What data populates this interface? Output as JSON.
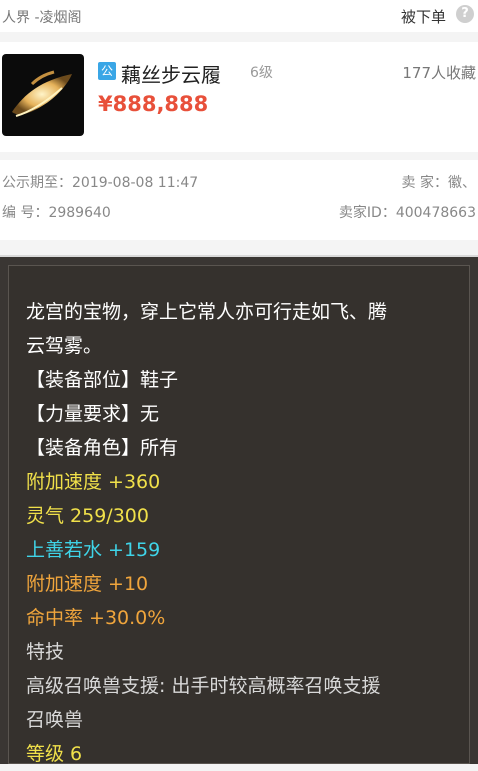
{
  "header": {
    "server": "人界 -凌烟阁",
    "orders_label": "被下单",
    "help_icon": "?"
  },
  "item": {
    "badge": "公",
    "name": "藕丝步云履",
    "level": "6级",
    "favorites": "177人收藏",
    "price": "¥888,888"
  },
  "info": {
    "announce_label": "公示期至：",
    "announce_value": "2019-08-08 11:47",
    "seller_label": "卖 家：",
    "seller_value": "徽、",
    "id_label": "编 号：",
    "id_value": "2989640",
    "seller_id_label": "卖家ID：",
    "seller_id_value": "400478663"
  },
  "description": {
    "line1": "龙宫的宝物，穿上它常人亦可行走如飞、腾",
    "line2": "云驾雾。",
    "line3": "【装备部位】鞋子",
    "line4": "【力量要求】无",
    "line5": "【装备角色】所有",
    "line6": "附加速度 +360",
    "line7": "灵气 259/300",
    "line8": "上善若水 +159",
    "line9": "附加速度 +10",
    "line10": "命中率 +30.0%",
    "line11": "特技",
    "line12": "高级召唤兽支援: 出手时较高概率召唤支援",
    "line13": "召唤兽",
    "line14": "等级 6"
  }
}
